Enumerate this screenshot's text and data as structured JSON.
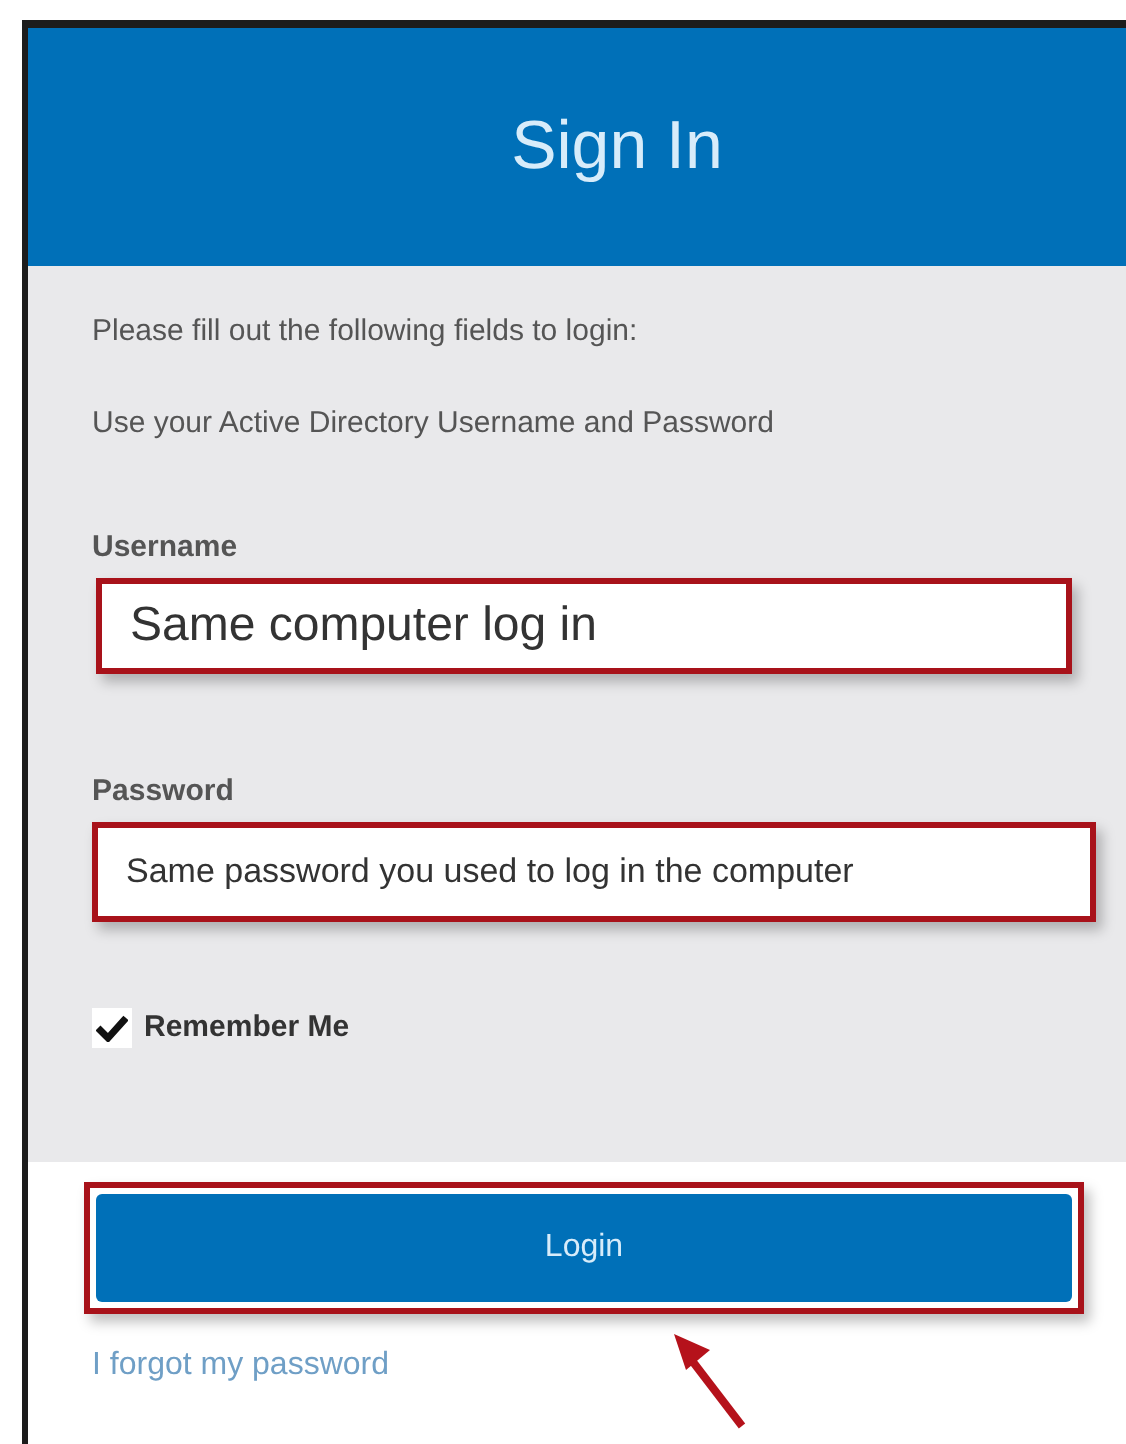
{
  "header": {
    "title": "Sign In"
  },
  "intro": [
    "Please fill out the following fields to login:",
    "Use your Active Directory Username and Password"
  ],
  "fields": [
    {
      "kind": "large",
      "label": "Username",
      "value": "Same computer log in"
    },
    {
      "kind": "normal",
      "label": "Password",
      "value": "Same password you used to log in the computer"
    }
  ],
  "remember": {
    "label": "Remember Me",
    "checked": true
  },
  "login_button": "Login",
  "forgot_link": "I forgot my password"
}
